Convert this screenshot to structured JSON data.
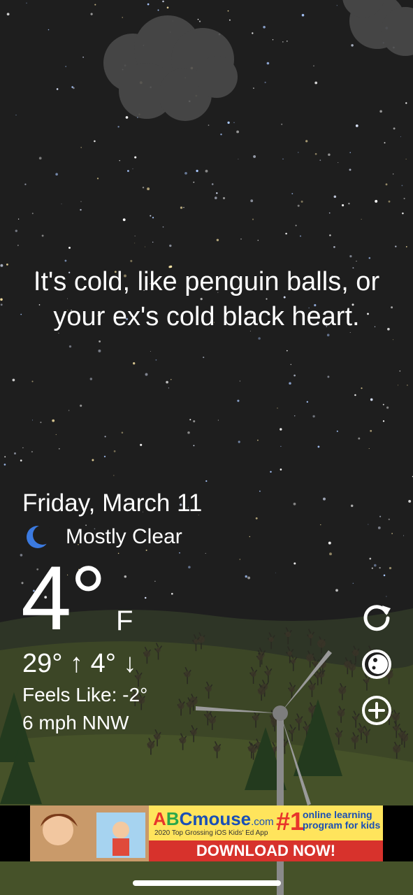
{
  "weather": {
    "quote": "It's cold, like penguin balls, or your ex's cold black heart.",
    "date": "Friday, March 11",
    "condition": "Mostly Clear",
    "condition_icon": "moon-icon",
    "temperature": "4°",
    "unit": "F",
    "high_low": "29° ↑  4° ↓",
    "feels_like": "Feels Like: -2°",
    "wind": "6 mph NNW"
  },
  "controls": {
    "refresh_icon": "refresh-icon",
    "moon_phase_icon": "moon-phase-icon",
    "add_icon": "add-icon"
  },
  "ad": {
    "brand_a": "A",
    "brand_b": "B",
    "brand_rest": "Cmouse",
    "brand_domain": ".com",
    "subtitle": "2020 Top Grossing iOS Kids' Ed App",
    "rank": "#1",
    "tagline": "online learning program for kids",
    "cta": "DOWNLOAD NOW!"
  },
  "colors": {
    "sky": "#1e1e1e",
    "hill": "#3c4626",
    "ad_red": "#d7322c",
    "ad_yellow": "#ffe45c",
    "brand_blue": "#1a4fb5"
  }
}
